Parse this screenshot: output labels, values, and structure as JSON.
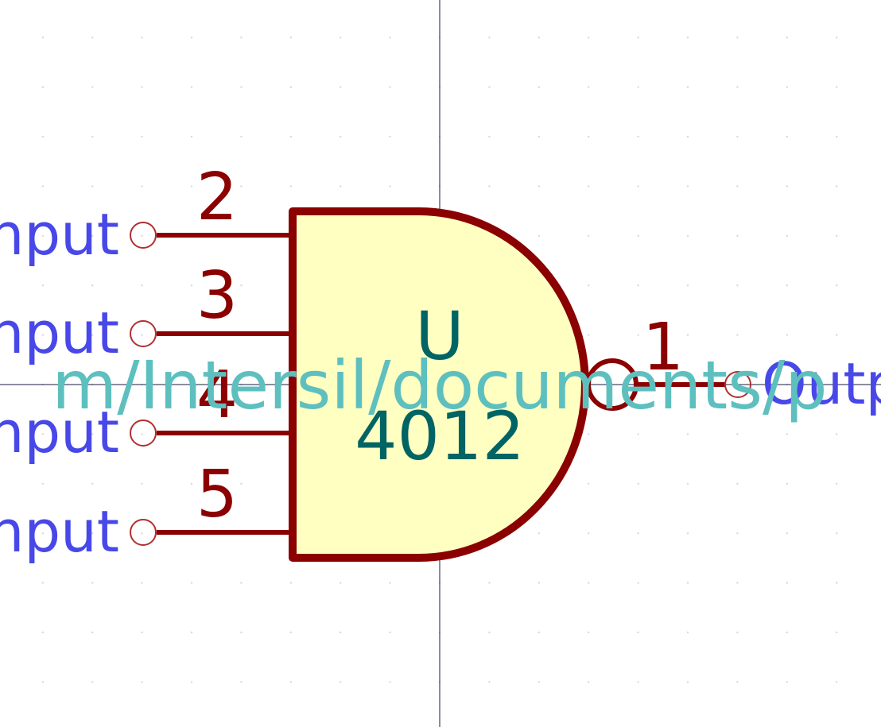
{
  "symbol": {
    "reference": "U",
    "value": "4012",
    "datasheet_text": "m/Intersil/documents/p",
    "colors": {
      "body_outline": "#8b0000",
      "body_fill": "#ffffc2",
      "pin": "#8b0000",
      "pin_number": "#8b0000",
      "pin_name": "#4848e8",
      "field": "#006464",
      "datasheet": "#5ebfbf",
      "axis": "#1a1a40",
      "grid_dot": "#d8d8d8"
    },
    "pins": [
      {
        "number": "2",
        "name": "nput"
      },
      {
        "number": "3",
        "name": "nput"
      },
      {
        "number": "4",
        "name": "nput"
      },
      {
        "number": "5",
        "name": "nput"
      },
      {
        "number": "1",
        "name": "Outp"
      }
    ]
  }
}
